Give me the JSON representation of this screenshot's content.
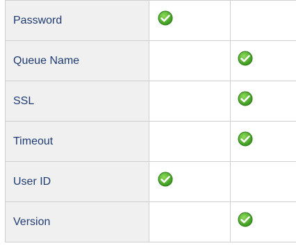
{
  "rows": [
    {
      "label": "Password",
      "col2": true,
      "col3": false
    },
    {
      "label": "Queue Name",
      "col2": false,
      "col3": true
    },
    {
      "label": "SSL",
      "col2": false,
      "col3": true
    },
    {
      "label": "Timeout",
      "col2": false,
      "col3": true
    },
    {
      "label": "User ID",
      "col2": true,
      "col3": false
    },
    {
      "label": "Version",
      "col2": false,
      "col3": true
    }
  ],
  "icons": {
    "check": "check-circle-icon"
  },
  "colors": {
    "label_cell_bg": "#f0f0f0",
    "label_text": "#1f3b73",
    "check_green": "#4caf2a",
    "grid_line": "#cfcfcf"
  }
}
